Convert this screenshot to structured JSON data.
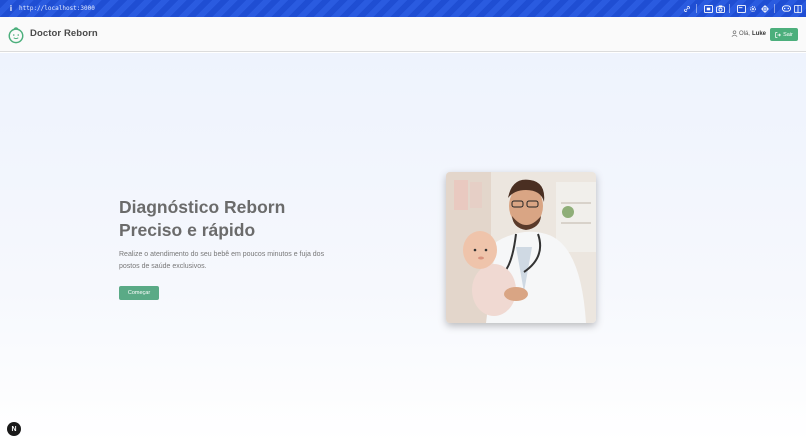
{
  "browser": {
    "info_icon": "info-icon",
    "url": "http://localhost:3000",
    "icons": [
      "link-icon",
      "screen-icon",
      "camera-icon",
      "window-icon",
      "gear-icon",
      "target-icon",
      "gamepad-icon",
      "sidebar-icon"
    ]
  },
  "header": {
    "brand": "Doctor Reborn",
    "greeting": "Olá,",
    "user_name": "Luke",
    "logout_label": "Sair"
  },
  "hero": {
    "title_line1": "Diagnóstico Reborn",
    "title_line2": "Preciso e rápido",
    "description": "Realize o atendimento do seu bebê em poucos minutos e fuja dos postos de saúde exclusivos.",
    "cta_label": "Começar"
  },
  "dev_badge": "N",
  "colors": {
    "browser_bar": "#1f4ed3",
    "accent_green": "#4caf7c",
    "cta_green": "#5aaa86",
    "title_gray": "#6b6b6b"
  }
}
